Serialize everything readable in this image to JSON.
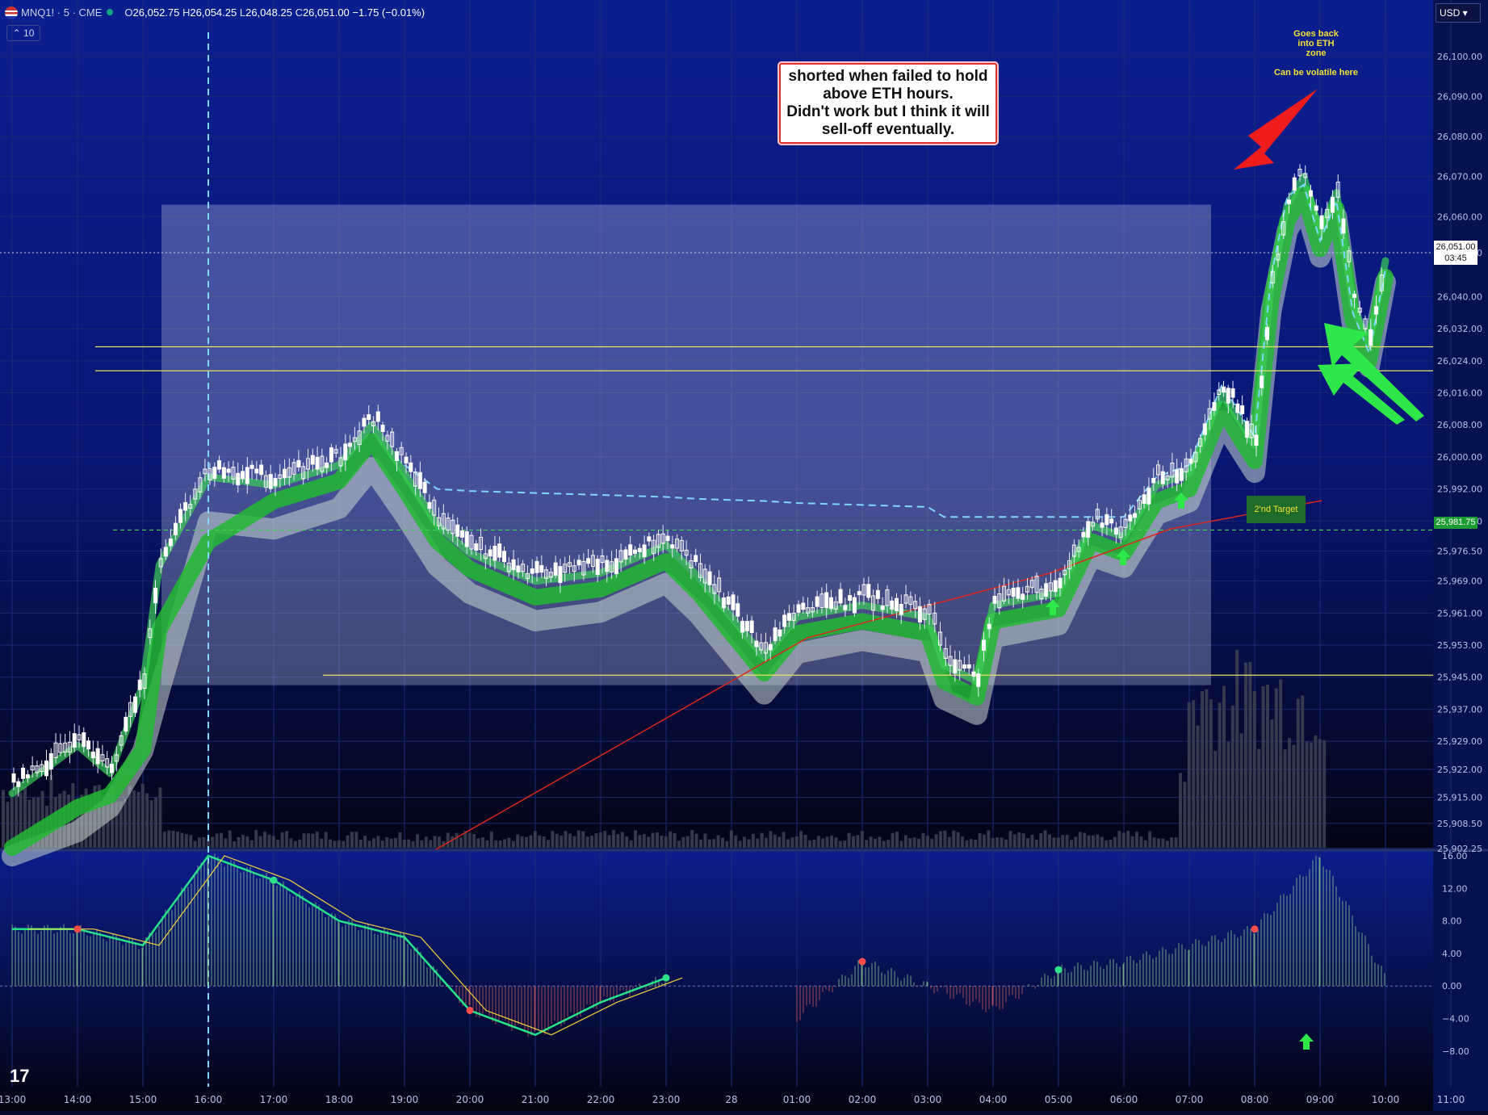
{
  "header": {
    "symbol": "MNQ1! · 5 · CME",
    "open": "26,052.75",
    "high": "26,054.25",
    "low": "26,048.25",
    "close": "26,051.00",
    "change": "−1.75 (−0.01%)",
    "open_prefix": "O",
    "high_prefix": "H",
    "low_prefix": "L",
    "close_prefix": "C",
    "interval_badge": "10",
    "currency": "USD"
  },
  "annotations": {
    "note_text": "shorted when failed to hold\nabove ETH hours.\nDidn't work but I think it will\nsell-off eventually.",
    "eth_zone": "Goes back\ninto ETH\nzone",
    "volatile": "Can be volatile here",
    "second_target": "2'nd Target"
  },
  "price_labels": {
    "last_price": "26,051.00",
    "countdown": "03:45",
    "line_price": "25,981.75"
  },
  "colors": {
    "bg_top": "#0a1f8f",
    "bg_bottom": "#04061c",
    "up_candle": "#ffffff",
    "down_candle": "#ffffff",
    "ribbon_fast": "#22b833",
    "ribbon_slow": "#c9d6cf",
    "vwap": "#7fd6ff",
    "red_line": "#d8281d",
    "yellow_line": "#e9e36a",
    "arrow_green": "#2ee84a",
    "arrow_red": "#ee1c1c"
  },
  "chart_data": [
    {
      "type": "candlestick",
      "title": "",
      "ylim": [
        25902,
        26102
      ],
      "y_ticks": [
        "26,100.00",
        "26,090.00",
        "26,080.00",
        "26,070.00",
        "26,060.00",
        "26,051.00",
        "26,040.00",
        "26,032.00",
        "26,024.00",
        "26,016.00",
        "26,008.00",
        "26,000.00",
        "25,992.00",
        "25,984.00",
        "25,976.50",
        "25,969.00",
        "25,961.00",
        "25,953.00",
        "25,945.00",
        "25,937.00",
        "25,929.00",
        "25,922.00",
        "25,915.00",
        "25,908.50",
        "25,902.25"
      ],
      "x_ticks": [
        "13:00",
        "14:00",
        "15:00",
        "16:00",
        "17:00",
        "18:00",
        "19:00",
        "20:00",
        "21:00",
        "22:00",
        "23:00",
        "28",
        "01:00",
        "02:00",
        "03:00",
        "04:00",
        "05:00",
        "06:00",
        "07:00",
        "08:00",
        "09:00",
        "10:00",
        "11:00"
      ],
      "horizontal_lines": [
        26027.5,
        26021.5,
        25945.5
      ],
      "dashed_line": 25981.75,
      "zone": {
        "y_top": 26063,
        "y_bottom": 25943
      },
      "key_points": [
        {
          "time": "13:00",
          "price": 25918
        },
        {
          "time": "14:00",
          "price": 25930
        },
        {
          "time": "14:30",
          "price": 25923
        },
        {
          "time": "15:00",
          "price": 25945
        },
        {
          "time": "15:15",
          "price": 25975
        },
        {
          "time": "16:00",
          "price": 25997
        },
        {
          "time": "17:00",
          "price": 25995
        },
        {
          "time": "18:00",
          "price": 26000
        },
        {
          "time": "18:30",
          "price": 26010
        },
        {
          "time": "19:00",
          "price": 25998
        },
        {
          "time": "19:30",
          "price": 25985
        },
        {
          "time": "20:00",
          "price": 25978
        },
        {
          "time": "21:00",
          "price": 25971
        },
        {
          "time": "22:00",
          "price": 25973
        },
        {
          "time": "23:00",
          "price": 25980
        },
        {
          "time": "23:30",
          "price": 25972
        },
        {
          "time": "00:30",
          "price": 25952
        },
        {
          "time": "01:00",
          "price": 25962
        },
        {
          "time": "02:00",
          "price": 25965
        },
        {
          "time": "03:00",
          "price": 25962
        },
        {
          "time": "03:15",
          "price": 25950
        },
        {
          "time": "03:45",
          "price": 25946
        },
        {
          "time": "04:00",
          "price": 25965
        },
        {
          "time": "05:00",
          "price": 25968
        },
        {
          "time": "05:30",
          "price": 25985
        },
        {
          "time": "06:00",
          "price": 25982
        },
        {
          "time": "06:30",
          "price": 25995
        },
        {
          "time": "07:00",
          "price": 25998
        },
        {
          "time": "07:30",
          "price": 26018
        },
        {
          "time": "08:00",
          "price": 26005
        },
        {
          "time": "08:15",
          "price": 26045
        },
        {
          "time": "08:30",
          "price": 26065
        },
        {
          "time": "08:45",
          "price": 26072
        },
        {
          "time": "09:00",
          "price": 26058
        },
        {
          "time": "09:15",
          "price": 26068
        },
        {
          "time": "09:30",
          "price": 26040
        },
        {
          "time": "09:45",
          "price": 26030
        },
        {
          "time": "10:00",
          "price": 26051
        }
      ]
    },
    {
      "type": "line",
      "title": "",
      "ylim": [
        -10,
        16
      ],
      "y_ticks": [
        "16.00",
        "12.00",
        "8.00",
        "4.00",
        "0.00",
        "−4.00",
        "−8.00"
      ],
      "series": [
        {
          "x": [
            "13:00",
            "14:00",
            "15:00",
            "16:00",
            "17:00",
            "18:00",
            "19:00",
            "20:00",
            "21:00",
            "22:00",
            "23:00",
            "28",
            "01:00",
            "02:00",
            "03:00",
            "04:00",
            "05:00",
            "06:00",
            "07:00",
            "08:00",
            "09:00",
            "10:00"
          ],
          "values": [
            7,
            7,
            5,
            16,
            13,
            8,
            6,
            -3,
            -6,
            -2,
            1,
            -2,
            -4,
            3,
            0,
            -3,
            2,
            3,
            5,
            7,
            16,
            1
          ]
        }
      ]
    }
  ]
}
